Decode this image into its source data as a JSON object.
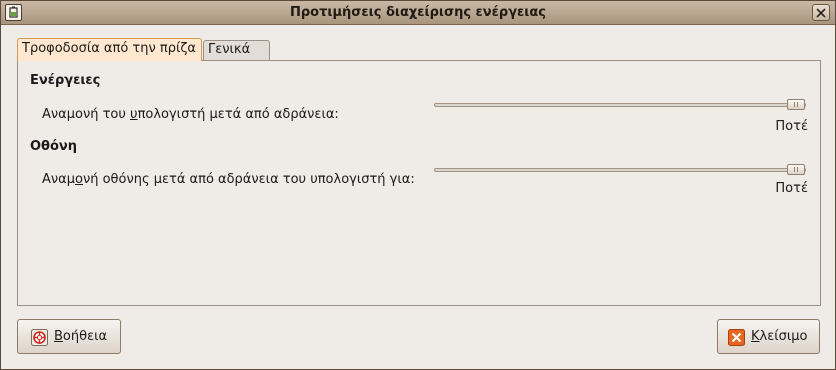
{
  "window": {
    "title": "Προτιμήσεις διαχείρισης ενέργειας"
  },
  "tabs": [
    {
      "label": "Τροφοδοσία από την πρίζα",
      "active": true
    },
    {
      "label": "Γενικά",
      "active": false
    }
  ],
  "actions": {
    "heading": "Ενέργειες",
    "sleep_label_pre": "Αναμονή του ",
    "sleep_label_mnemonic": "υ",
    "sleep_label_post": "πολογιστή μετά από αδράνεια:",
    "sleep_value": "Ποτέ",
    "sleep_slider_fraction": 1.0
  },
  "display": {
    "heading": "Οθόνη",
    "sleep_label_pre": "Αναμ",
    "sleep_label_mnemonic": "ο",
    "sleep_label_post": "νή οθόνης μετά από αδράνεια του υπολογιστή για:",
    "sleep_value": "Ποτέ",
    "sleep_slider_fraction": 1.0
  },
  "buttons": {
    "help_mnemonic": "Β",
    "help_rest": "οήθεια",
    "close_mnemonic": "Κ",
    "close_rest": "λείσιμο"
  },
  "icons": {
    "app": "battery-settings-icon",
    "window_close": "window-close-icon",
    "help": "help-lifebuoy-icon",
    "close": "close-x-icon"
  },
  "colors": {
    "active_tab": "#ffe8cf",
    "close_icon": "#e8661e"
  }
}
